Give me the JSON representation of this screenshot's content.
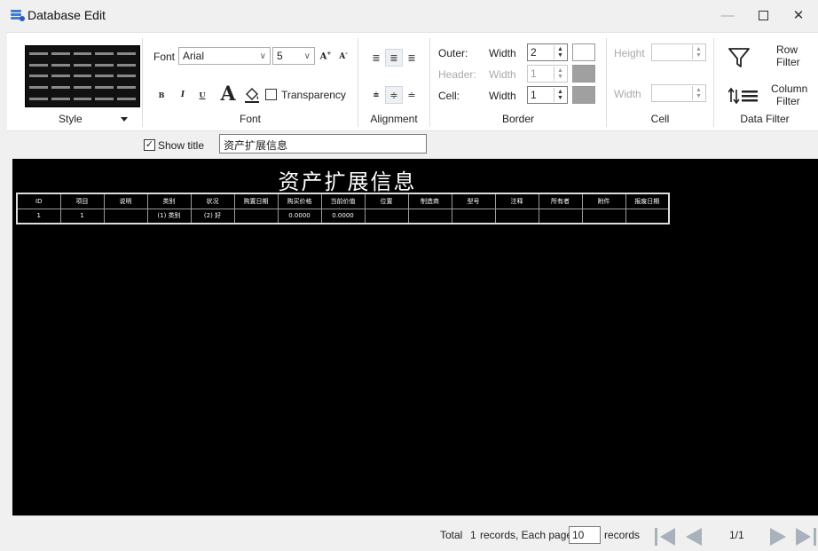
{
  "window": {
    "title": "Database Edit",
    "icon": "database-edit-icon",
    "controls": [
      "minimize-icon",
      "maximize-icon",
      "close-icon"
    ]
  },
  "ribbon": {
    "style": {
      "label": "Style"
    },
    "font": {
      "label": "Font",
      "font_label": "Font",
      "font_value": "Arial",
      "size_value": "5",
      "transparency_label": "Transparency",
      "bold_glyph": "B",
      "italic_glyph": "I",
      "underline_glyph": "U",
      "big_a_glyph": "A"
    },
    "alignment": {
      "label": "Alignment"
    },
    "border": {
      "label": "Border",
      "outer_label": "Outer:",
      "header_label": "Header:",
      "cell_label": "Cell:",
      "width_label": "Width",
      "outer_width": "2",
      "header_width": "1",
      "cell_width": "1",
      "outer_color": "#ffffff",
      "header_color": "#a0a0a0",
      "cell_color": "#a0a0a0"
    },
    "cell": {
      "label": "Cell",
      "height_label": "Height",
      "width_label": "Width"
    },
    "data_filter": {
      "label": "Data Filter",
      "row_filter_line1": "Row",
      "row_filter_line2": "Filter",
      "column_filter_line1": "Column",
      "column_filter_line2": "Filter"
    }
  },
  "options": {
    "show_title_label": "Show title",
    "show_title_checked": true,
    "title_value": "资产扩展信息"
  },
  "preview": {
    "title": "资产扩展信息",
    "headers": [
      "ID",
      "项目",
      "说明",
      "类别",
      "状况",
      "购置日期",
      "购买价格",
      "当前价值",
      "位置",
      "制造商",
      "型号",
      "注释",
      "所有者",
      "附件",
      "报废日期"
    ],
    "rows": [
      [
        "1",
        "1",
        "",
        "(1) 类别",
        "(2) 好",
        "",
        "0.0000",
        "0.0000",
        "",
        "",
        "",
        "",
        "",
        "",
        ""
      ]
    ]
  },
  "status": {
    "total_label": "Total",
    "total_count": "1",
    "records_each_page_label": "records, Each page",
    "page_size": "10",
    "records_label": "records",
    "page_indicator": "1/1"
  },
  "colors": {
    "canvas_bg": "#000000",
    "nav_arrow": "#a9b1bb"
  }
}
